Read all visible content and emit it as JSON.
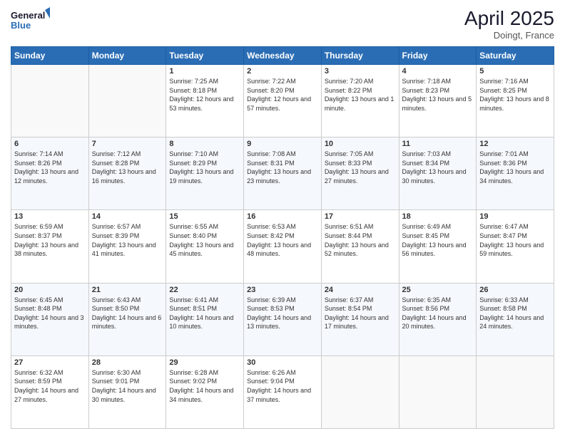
{
  "header": {
    "logo_line1": "General",
    "logo_line2": "Blue",
    "title": "April 2025",
    "subtitle": "Doingt, France"
  },
  "weekdays": [
    "Sunday",
    "Monday",
    "Tuesday",
    "Wednesday",
    "Thursday",
    "Friday",
    "Saturday"
  ],
  "weeks": [
    [
      {
        "day": "",
        "info": ""
      },
      {
        "day": "",
        "info": ""
      },
      {
        "day": "1",
        "info": "Sunrise: 7:25 AM\nSunset: 8:18 PM\nDaylight: 12 hours and 53 minutes."
      },
      {
        "day": "2",
        "info": "Sunrise: 7:22 AM\nSunset: 8:20 PM\nDaylight: 12 hours and 57 minutes."
      },
      {
        "day": "3",
        "info": "Sunrise: 7:20 AM\nSunset: 8:22 PM\nDaylight: 13 hours and 1 minute."
      },
      {
        "day": "4",
        "info": "Sunrise: 7:18 AM\nSunset: 8:23 PM\nDaylight: 13 hours and 5 minutes."
      },
      {
        "day": "5",
        "info": "Sunrise: 7:16 AM\nSunset: 8:25 PM\nDaylight: 13 hours and 8 minutes."
      }
    ],
    [
      {
        "day": "6",
        "info": "Sunrise: 7:14 AM\nSunset: 8:26 PM\nDaylight: 13 hours and 12 minutes."
      },
      {
        "day": "7",
        "info": "Sunrise: 7:12 AM\nSunset: 8:28 PM\nDaylight: 13 hours and 16 minutes."
      },
      {
        "day": "8",
        "info": "Sunrise: 7:10 AM\nSunset: 8:29 PM\nDaylight: 13 hours and 19 minutes."
      },
      {
        "day": "9",
        "info": "Sunrise: 7:08 AM\nSunset: 8:31 PM\nDaylight: 13 hours and 23 minutes."
      },
      {
        "day": "10",
        "info": "Sunrise: 7:05 AM\nSunset: 8:33 PM\nDaylight: 13 hours and 27 minutes."
      },
      {
        "day": "11",
        "info": "Sunrise: 7:03 AM\nSunset: 8:34 PM\nDaylight: 13 hours and 30 minutes."
      },
      {
        "day": "12",
        "info": "Sunrise: 7:01 AM\nSunset: 8:36 PM\nDaylight: 13 hours and 34 minutes."
      }
    ],
    [
      {
        "day": "13",
        "info": "Sunrise: 6:59 AM\nSunset: 8:37 PM\nDaylight: 13 hours and 38 minutes."
      },
      {
        "day": "14",
        "info": "Sunrise: 6:57 AM\nSunset: 8:39 PM\nDaylight: 13 hours and 41 minutes."
      },
      {
        "day": "15",
        "info": "Sunrise: 6:55 AM\nSunset: 8:40 PM\nDaylight: 13 hours and 45 minutes."
      },
      {
        "day": "16",
        "info": "Sunrise: 6:53 AM\nSunset: 8:42 PM\nDaylight: 13 hours and 48 minutes."
      },
      {
        "day": "17",
        "info": "Sunrise: 6:51 AM\nSunset: 8:44 PM\nDaylight: 13 hours and 52 minutes."
      },
      {
        "day": "18",
        "info": "Sunrise: 6:49 AM\nSunset: 8:45 PM\nDaylight: 13 hours and 56 minutes."
      },
      {
        "day": "19",
        "info": "Sunrise: 6:47 AM\nSunset: 8:47 PM\nDaylight: 13 hours and 59 minutes."
      }
    ],
    [
      {
        "day": "20",
        "info": "Sunrise: 6:45 AM\nSunset: 8:48 PM\nDaylight: 14 hours and 3 minutes."
      },
      {
        "day": "21",
        "info": "Sunrise: 6:43 AM\nSunset: 8:50 PM\nDaylight: 14 hours and 6 minutes."
      },
      {
        "day": "22",
        "info": "Sunrise: 6:41 AM\nSunset: 8:51 PM\nDaylight: 14 hours and 10 minutes."
      },
      {
        "day": "23",
        "info": "Sunrise: 6:39 AM\nSunset: 8:53 PM\nDaylight: 14 hours and 13 minutes."
      },
      {
        "day": "24",
        "info": "Sunrise: 6:37 AM\nSunset: 8:54 PM\nDaylight: 14 hours and 17 minutes."
      },
      {
        "day": "25",
        "info": "Sunrise: 6:35 AM\nSunset: 8:56 PM\nDaylight: 14 hours and 20 minutes."
      },
      {
        "day": "26",
        "info": "Sunrise: 6:33 AM\nSunset: 8:58 PM\nDaylight: 14 hours and 24 minutes."
      }
    ],
    [
      {
        "day": "27",
        "info": "Sunrise: 6:32 AM\nSunset: 8:59 PM\nDaylight: 14 hours and 27 minutes."
      },
      {
        "day": "28",
        "info": "Sunrise: 6:30 AM\nSunset: 9:01 PM\nDaylight: 14 hours and 30 minutes."
      },
      {
        "day": "29",
        "info": "Sunrise: 6:28 AM\nSunset: 9:02 PM\nDaylight: 14 hours and 34 minutes."
      },
      {
        "day": "30",
        "info": "Sunrise: 6:26 AM\nSunset: 9:04 PM\nDaylight: 14 hours and 37 minutes."
      },
      {
        "day": "",
        "info": ""
      },
      {
        "day": "",
        "info": ""
      },
      {
        "day": "",
        "info": ""
      }
    ]
  ]
}
